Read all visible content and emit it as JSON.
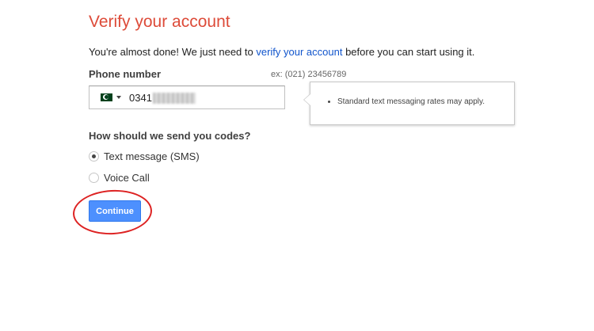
{
  "header": {
    "title": "Verify your account"
  },
  "intro": {
    "before": "You're almost done! We just need to ",
    "link": "verify your account",
    "after": " before you can start using it."
  },
  "phone": {
    "label": "Phone number",
    "example": "ex: (021) 23456789",
    "country": "Pakistan",
    "value": "0341",
    "tooltip": "Standard text messaging rates may apply."
  },
  "codes": {
    "question": "How should we send you codes?",
    "options": [
      {
        "label": "Text message (SMS)",
        "selected": true
      },
      {
        "label": "Voice Call",
        "selected": false
      }
    ]
  },
  "actions": {
    "continue_label": "Continue",
    "button_color": "#4d90fe",
    "highlight_color": "#dd2222"
  },
  "colors": {
    "title": "#dd4b39",
    "link": "#1155cc"
  }
}
